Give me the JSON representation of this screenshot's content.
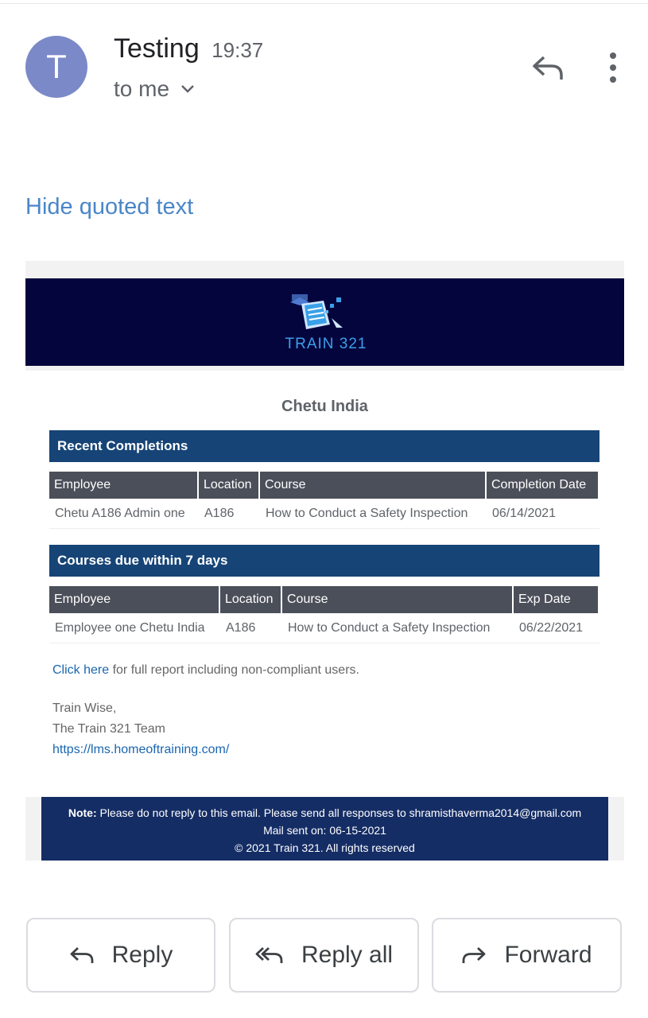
{
  "header": {
    "avatar_letter": "T",
    "sender": "Testing",
    "time": "19:37",
    "recipient": "to me"
  },
  "hide_quoted": "Hide quoted text",
  "email": {
    "logo_text": "TRAIN 321",
    "org": "Chetu India",
    "recent": {
      "title": "Recent Completions",
      "columns": [
        "Employee",
        "Location",
        "Course",
        "Completion Date"
      ],
      "rows": [
        [
          "Chetu A186 Admin one",
          "A186",
          "How to Conduct a Safety Inspection",
          "06/14/2021"
        ]
      ]
    },
    "due": {
      "title": "Courses due within 7 days",
      "columns": [
        "Employee",
        "Location",
        "Course",
        "Exp Date"
      ],
      "rows": [
        [
          "Employee one Chetu India",
          "A186",
          "How to Conduct a Safety Inspection",
          "06/22/2021"
        ]
      ]
    },
    "click_here": "Click here",
    "report_text": " for full report including non-compliant users.",
    "signoff": "Train Wise,",
    "team": "The Train 321 Team",
    "site": "https://lms.homeoftraining.com/",
    "footer": {
      "note_label": "Note:",
      "note_text": " Please do not reply to this email. Please send all responses to shramisthaverma2014@gmail.com",
      "sent": "Mail sent on: 06-15-2021",
      "copyright": "© 2021 Train 321. All rights reserved"
    }
  },
  "actions": {
    "reply": "Reply",
    "reply_all": "Reply all",
    "forward": "Forward"
  },
  "colors": {
    "banner": "#05053e",
    "section_bar": "#164476",
    "table_header": "#4b4f59",
    "footer": "#152d65",
    "link": "#1a66b0",
    "avatar": "#7b89c8"
  },
  "icons": [
    "reply-icon",
    "more-vert-icon",
    "chevron-down-icon",
    "reply-all-icon",
    "forward-icon",
    "train321-logo"
  ]
}
